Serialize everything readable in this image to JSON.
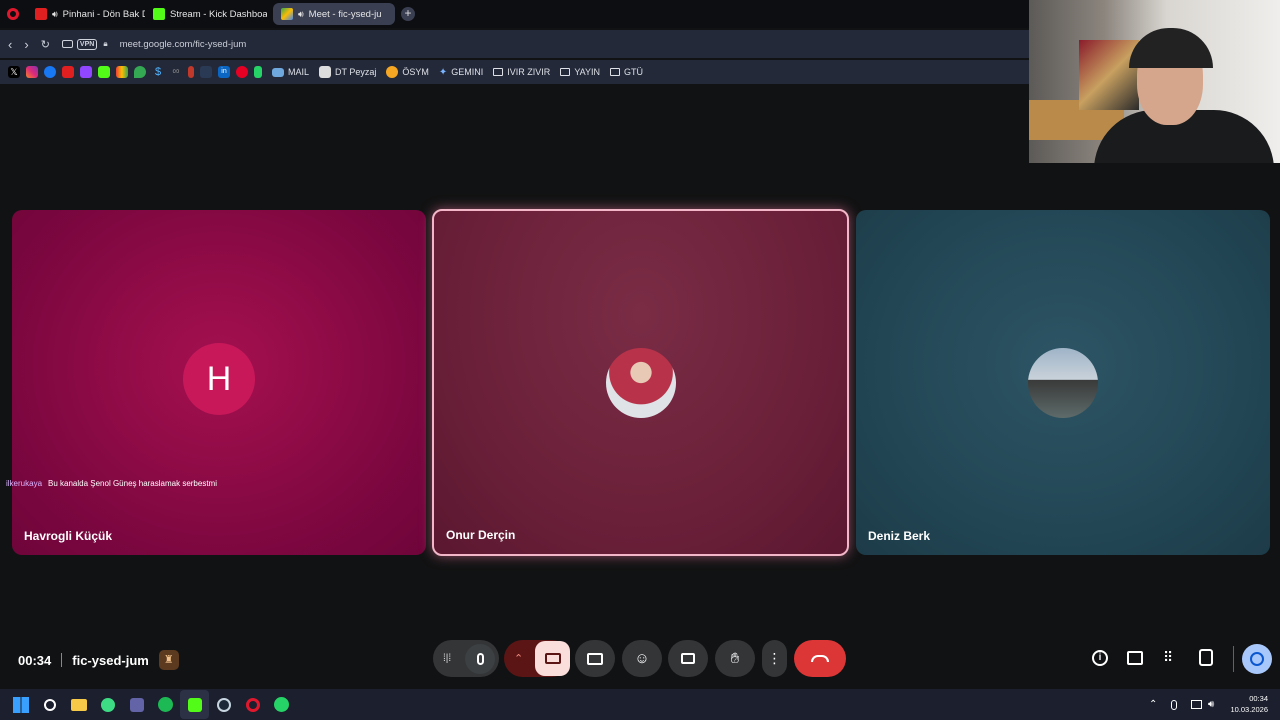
{
  "browser": {
    "tabs": [
      {
        "label": "Pinhani - Dön Bak Dün",
        "active": false
      },
      {
        "label": "Stream - Kick Dashboard",
        "active": false
      },
      {
        "label": "Meet - fic-ysed-ju",
        "active": true
      }
    ],
    "url": "meet.google.com/fic-ysed-jum",
    "vpn_label": "VPN",
    "bookmarks": [
      {
        "label": "MAIL"
      },
      {
        "label": "DT Peyzaj"
      },
      {
        "label": "ÖSYM"
      },
      {
        "label": "GEMINI"
      },
      {
        "label": "IVIR ZIVIR"
      },
      {
        "label": "YAYIN"
      },
      {
        "label": "GTÜ"
      }
    ]
  },
  "participants": [
    {
      "name": "Havrogli Küçük",
      "initial": "H",
      "color": "#c8185a"
    },
    {
      "name": "Onur Derçin",
      "speaking": true
    },
    {
      "name": "Deniz Berk"
    }
  ],
  "chat_overlay": {
    "user": "ilkerukaya",
    "message": "Bu kanalda Şenol Güneş haraslamak serbestmi"
  },
  "meeting": {
    "time": "00:34",
    "code": "fic-ysed-jum"
  },
  "controls": [
    "audio-levels",
    "microphone",
    "camera-options",
    "camera-off",
    "present-screen",
    "reactions",
    "captions",
    "raise-hand",
    "more-options",
    "leave-call"
  ],
  "side_controls": [
    "info",
    "chat",
    "activities",
    "host-controls",
    "timer"
  ],
  "system_tray": {
    "time": "00:34",
    "date": "10.03.2026"
  },
  "colors": {
    "accent_speaking": "#f2b6c8",
    "leave": "#dc3636",
    "camera_off": "#f9dedc"
  }
}
